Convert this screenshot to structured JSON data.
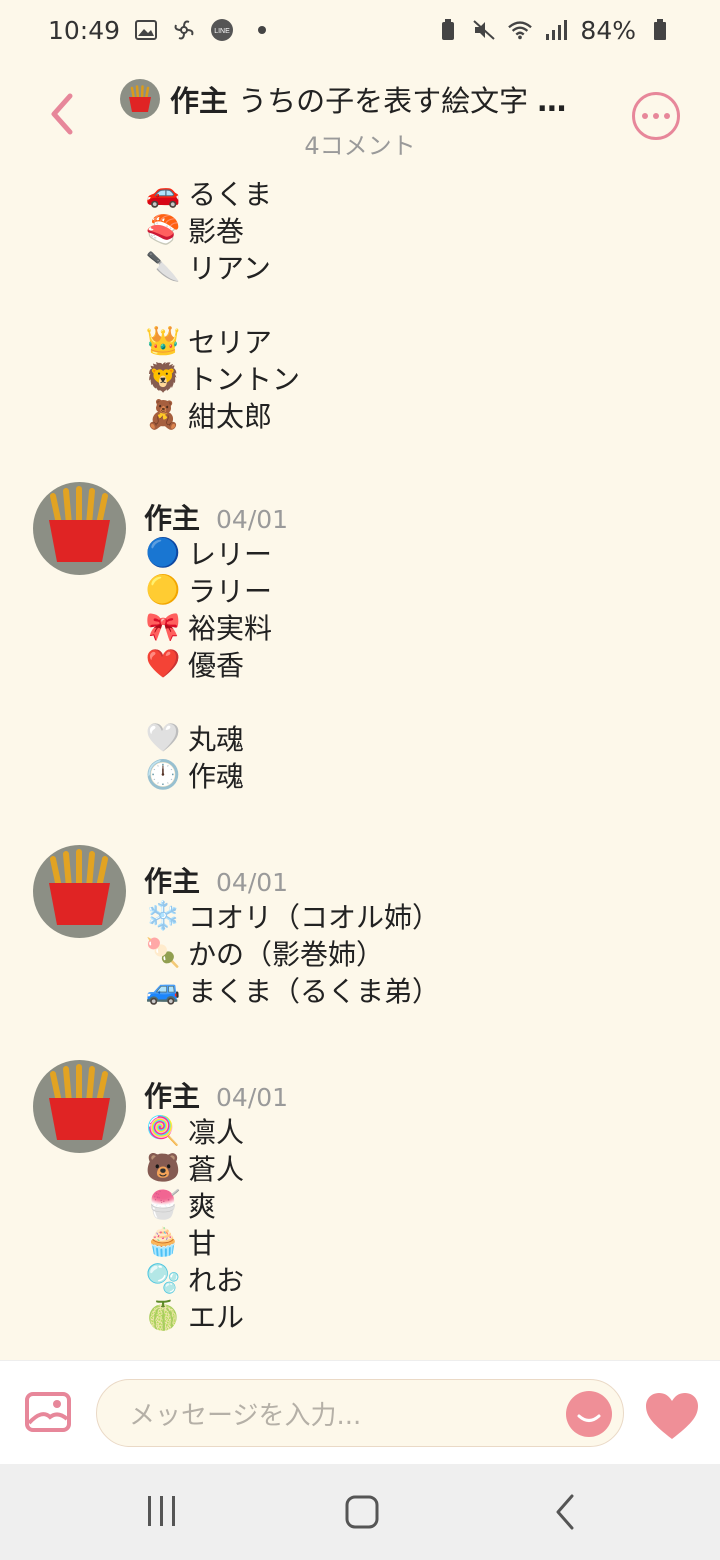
{
  "status_bar": {
    "time": "10:49",
    "battery": "84%"
  },
  "header": {
    "author": "作主",
    "title": "うちの子を表す絵文字 🟡…",
    "subtitle": "4コメント"
  },
  "comments": [
    {
      "partial": true,
      "lines": [
        {
          "emoji": "🚗",
          "text": "るくま"
        },
        {
          "emoji": "🍣",
          "text": "影巻"
        },
        {
          "emoji": "🔪",
          "text": "リアン"
        },
        {
          "emoji": "",
          "text": ""
        },
        {
          "emoji": "👑",
          "text": "セリア"
        },
        {
          "emoji": "🦁",
          "text": "トントン"
        },
        {
          "emoji": "🧸",
          "text": "紺太郎"
        }
      ]
    },
    {
      "author": "作主",
      "date": "04/01",
      "lines": [
        {
          "emoji": "🔵",
          "text": "レリー"
        },
        {
          "emoji": "🟡",
          "text": "ラリー"
        },
        {
          "emoji": "🎀",
          "text": "裕実料"
        },
        {
          "emoji": "❤️",
          "text": "優香"
        },
        {
          "emoji": "",
          "text": ""
        },
        {
          "emoji": "🤍",
          "text": "丸魂"
        },
        {
          "emoji": "🕛",
          "text": "作魂"
        }
      ]
    },
    {
      "author": "作主",
      "date": "04/01",
      "lines": [
        {
          "emoji": "❄️",
          "text": "コオリ（コオル姉）"
        },
        {
          "emoji": "🍡",
          "text": "かの（影巻姉）"
        },
        {
          "emoji": "🚙",
          "text": "まくま（るくま弟）"
        }
      ]
    },
    {
      "author": "作主",
      "date": "04/01",
      "lines": [
        {
          "emoji": "🍭",
          "text": "凛人"
        },
        {
          "emoji": "🐻",
          "text": "蒼人"
        },
        {
          "emoji": "🍧",
          "text": "爽"
        },
        {
          "emoji": "🧁",
          "text": "甘"
        },
        {
          "emoji": "🫧",
          "text": "れお"
        },
        {
          "emoji": "🍈",
          "text": "エル"
        }
      ]
    }
  ],
  "input": {
    "placeholder": "メッセージを入力..."
  },
  "icons": {
    "avatar": "french-fries-icon",
    "back": "chevron-left-icon",
    "more": "more-options-icon"
  },
  "colors": {
    "accent": "#e7879a",
    "background": "#fdf8ea"
  }
}
